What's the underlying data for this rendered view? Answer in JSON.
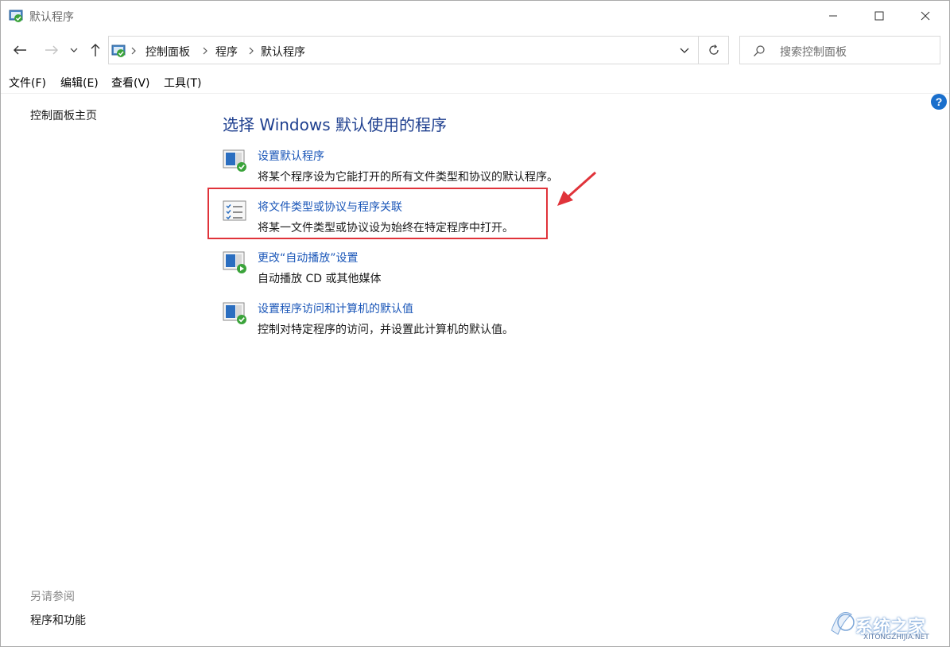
{
  "window": {
    "title": "默认程序"
  },
  "address": {
    "crumbs": [
      "控制面板",
      "程序",
      "默认程序"
    ]
  },
  "search": {
    "placeholder": "搜索控制面板"
  },
  "menu": [
    "文件(F)",
    "编辑(E)",
    "查看(V)",
    "工具(T)"
  ],
  "help": "?",
  "left": {
    "home": "控制面板主页",
    "see_also": "另请参阅",
    "link": "程序和功能"
  },
  "main": {
    "title": "选择 Windows 默认使用的程序",
    "tasks": [
      {
        "link": "设置默认程序",
        "desc": "将某个程序设为它能打开的所有文件类型和协议的默认程序。",
        "icon": "default-programs-icon"
      },
      {
        "link": "将文件类型或协议与程序关联",
        "desc": "将某一文件类型或协议设为始终在特定程序中打开。",
        "icon": "file-association-icon"
      },
      {
        "link": "更改“自动播放”设置",
        "desc": "自动播放 CD 或其他媒体",
        "icon": "autoplay-icon"
      },
      {
        "link": "设置程序访问和计算机的默认值",
        "desc": "控制对特定程序的访问，并设置此计算机的默认值。",
        "icon": "program-access-icon"
      }
    ]
  },
  "colors": {
    "link": "#1a56b8",
    "title": "#1e3f8f",
    "highlight": "#e0333a"
  },
  "watermark": {
    "text": "系统之家",
    "url": "XITONGZHIJIA.NET"
  }
}
